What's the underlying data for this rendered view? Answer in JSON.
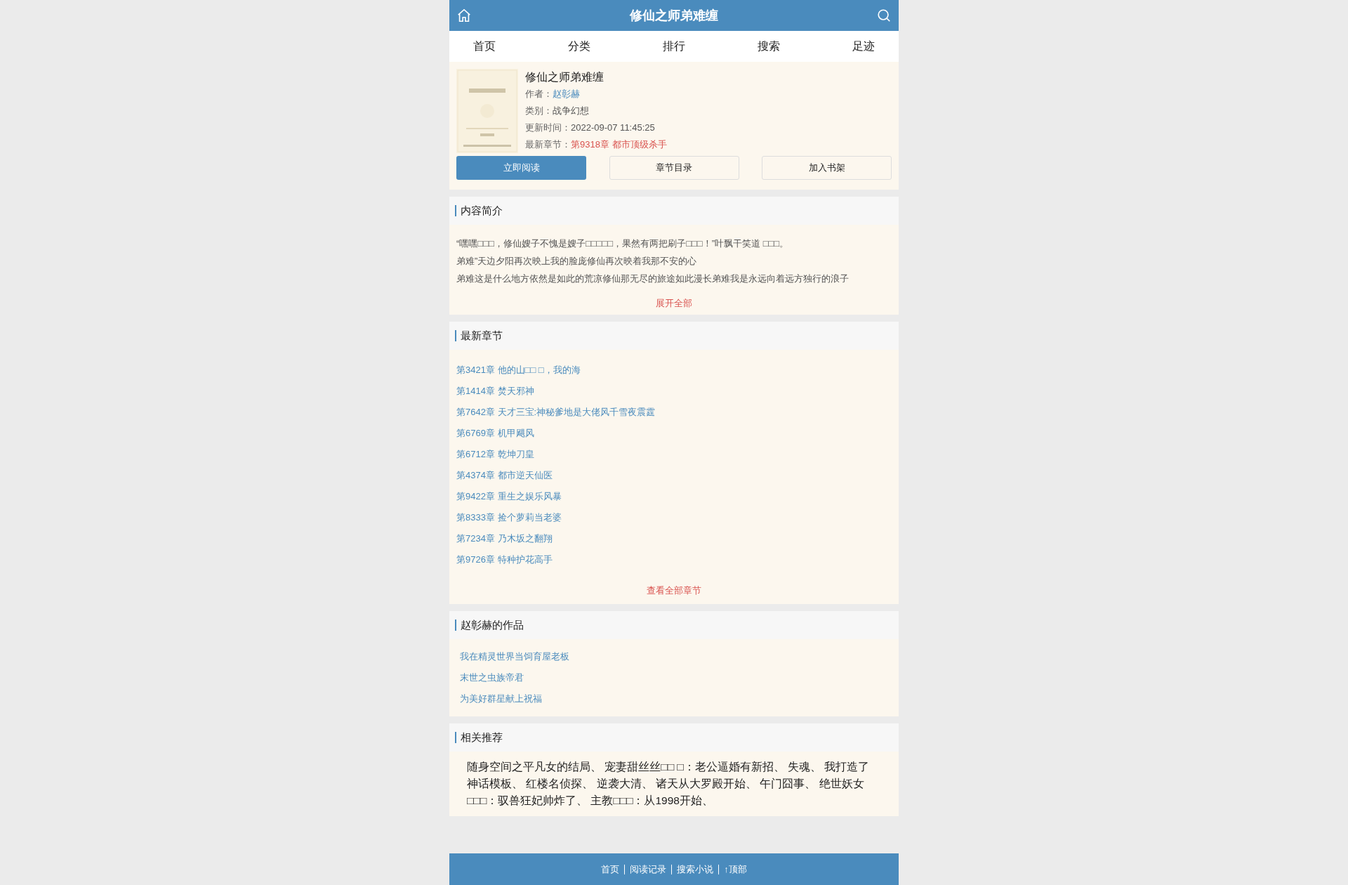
{
  "header": {
    "title": "修仙之师弟难缠"
  },
  "nav": [
    "首页",
    "分类",
    "排行",
    "搜索",
    "足迹"
  ],
  "book": {
    "kind": "picture",
    "title": "修仙之师弟难缠",
    "meta": [
      {
        "label": "作者：",
        "value": "赵彰赫",
        "kind": "link"
      },
      {
        "label": "类别：",
        "value": "战争幻想",
        "kind": "plain"
      },
      {
        "label": "更新时间：",
        "value": "2022-09-07 11:45:25",
        "kind": "plain"
      },
      {
        "label": "最新章节：",
        "value": "第9318章 都市顶级杀手",
        "kind": "latest"
      }
    ],
    "buttons": [
      {
        "label": "立即阅读",
        "primary": true
      },
      {
        "label": "章节目录",
        "primary": false
      },
      {
        "label": "加入书架",
        "primary": false
      }
    ]
  },
  "intro": {
    "heading": "内容简介",
    "lines": [
      "“嘿嘿□□□，修仙嫂子不愧是嫂子□□□□□，果然有两把刷子□□□！”叶飘干笑道 □□□。",
      "弟难”天边夕阳再次映上我的脸庞修仙再次映着我那不安的心",
      "弟难这是什么地方依然是如此的荒凉修仙那无尽的旅途如此漫长弟难我是永远向着远方独行的浪子"
    ],
    "more": "展开全部"
  },
  "latest": {
    "heading": "最新章节",
    "chapters": [
      "第3421章 他的山□□ □，我的海",
      "第1414章 焚天邪神",
      "第7642章 天才三宝:神秘爹地是大佬风千雪夜震霆",
      "第6769章 机甲飓风",
      "第6712章 乾坤刀皇",
      "第4374章 都市逆天仙医",
      "第9422章 重生之娱乐风暴",
      "第8333章 捡个萝莉当老婆",
      "第7234章 乃木坂之翻翔",
      "第9726章 特种护花高手"
    ],
    "more": "查看全部章节"
  },
  "works": {
    "heading": "赵彰赫的作品",
    "items": [
      "我在精灵世界当饲育屋老板",
      "末世之虫族帝君",
      "为美好群星献上祝福"
    ]
  },
  "related": {
    "heading": "相关推荐",
    "text": "随身空间之平凡女的结局、 宠妻甜丝丝□□ □：老公逼婚有新招、 失魂、 我打造了神话模板、 红楼名侦探、 逆袭大清、 诸天从大罗殿开始、 午门囧事、 绝世妖女□□□：驭兽狂妃帅炸了、 主教□□□：从1998开始、"
  },
  "footer": [
    "首页",
    "阅读记录",
    "搜索小说",
    "↑顶部"
  ]
}
